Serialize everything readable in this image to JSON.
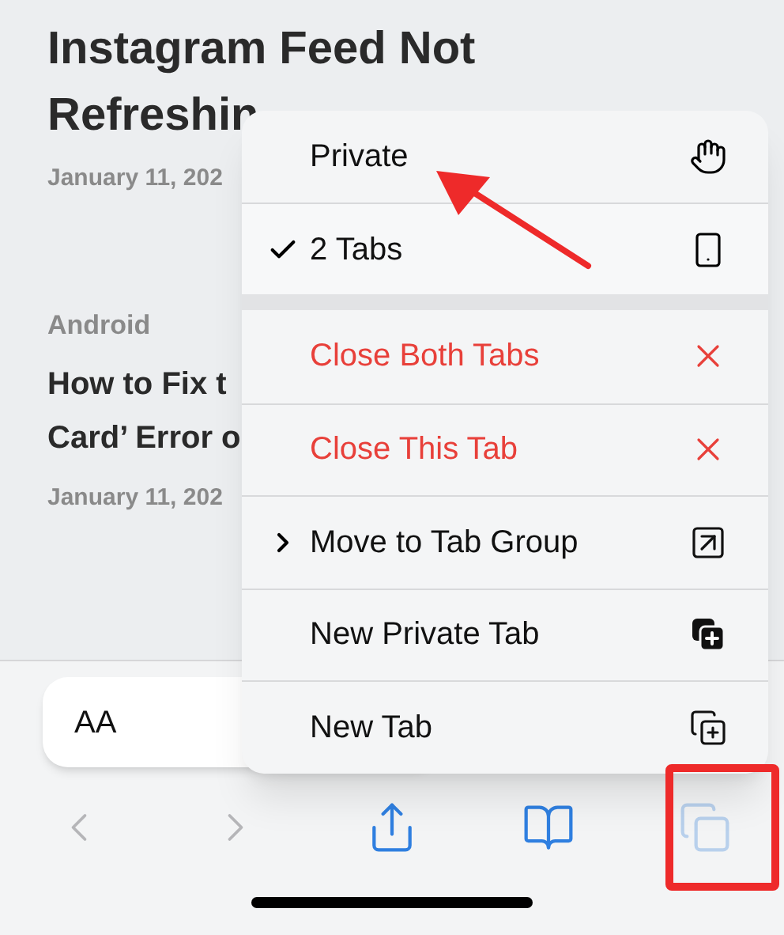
{
  "article": {
    "title_lines": [
      "Instagram Feed Not",
      "Refreshin"
    ],
    "date": "January 11, 202"
  },
  "next_article": {
    "category": "Android",
    "title_lines": [
      "How to Fix t",
      "Card’ Error o"
    ],
    "date": "January 11, 202"
  },
  "reader_button": {
    "label": "AA"
  },
  "menu": {
    "tab_groups": [
      {
        "label": "Private",
        "selected": false
      },
      {
        "label": "2 Tabs",
        "selected": true
      }
    ],
    "actions": [
      {
        "label": "Close Both Tabs",
        "kind": "destructive"
      },
      {
        "label": "Close This Tab",
        "kind": "destructive"
      },
      {
        "label": "Move to Tab Group",
        "kind": "submenu"
      },
      {
        "label": "New Private Tab",
        "kind": "plain"
      },
      {
        "label": "New Tab",
        "kind": "plain"
      }
    ]
  },
  "toolbar": [
    {
      "disabled": true
    },
    {
      "disabled": true
    },
    {
      "disabled": false
    },
    {
      "disabled": false
    },
    {
      "disabled": false,
      "pressed": true
    }
  ]
}
